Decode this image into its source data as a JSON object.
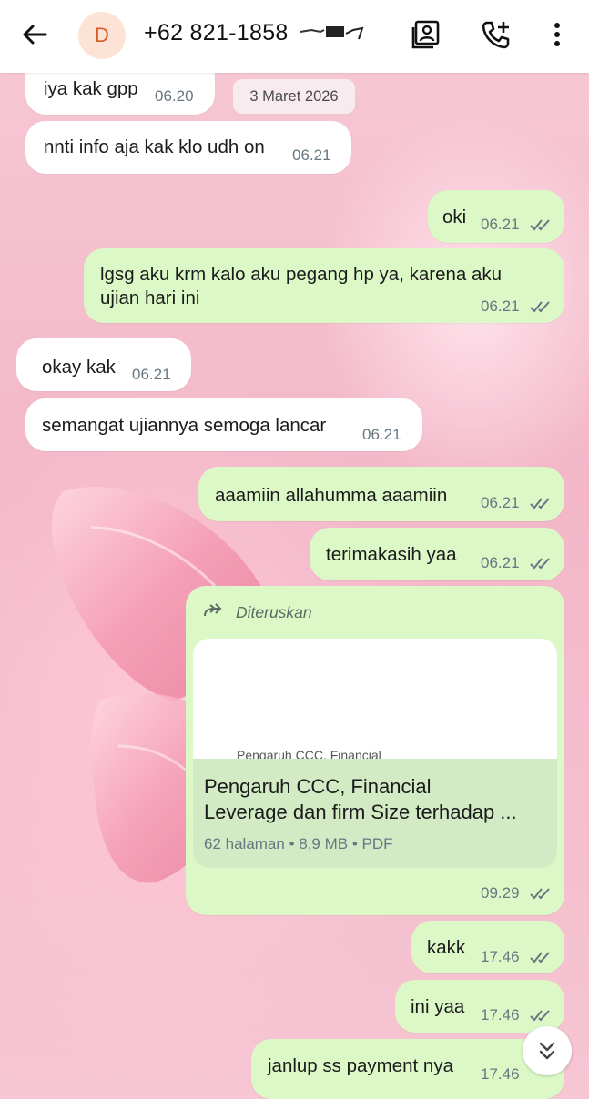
{
  "header": {
    "avatar_letter": "D",
    "contact_number": "+62 821-1858"
  },
  "date_chip": "3 Maret 2026",
  "messages": [
    {
      "dir": "in",
      "text": "iya kak gpp",
      "time": "06.20"
    },
    {
      "dir": "in",
      "text": "nnti info aja kak klo udh on",
      "time": "06.21"
    },
    {
      "dir": "out",
      "text": "oki",
      "time": "06.21"
    },
    {
      "dir": "out",
      "line1": "lgsg aku krm kalo aku pegang hp ya, karena aku",
      "line2": "ujian hari ini",
      "time": "06.21"
    },
    {
      "dir": "in",
      "text": "okay kak",
      "time": "06.21"
    },
    {
      "dir": "in",
      "text": "semangat ujiannya semoga lancar",
      "time": "06.21"
    },
    {
      "dir": "out",
      "text": "aaamiin allahumma aaamiin",
      "time": "06.21"
    },
    {
      "dir": "out",
      "text": "terimakasih yaa",
      "time": "06.21"
    },
    {
      "dir": "out",
      "forwarded_label": "Diteruskan",
      "doc": {
        "preview_text": "Pengaruh CCC, Financial",
        "title_line1": "Pengaruh CCC, Financial",
        "title_line2": "Leverage dan firm Size terhadap ...",
        "meta": "62 halaman • 8,9 MB • PDF"
      },
      "time": "09.29"
    },
    {
      "dir": "out",
      "text": "kakk",
      "time": "17.46"
    },
    {
      "dir": "out",
      "text": "ini yaa",
      "time": "17.46"
    },
    {
      "dir": "out",
      "text": "janlup ss payment nya",
      "time": "17.46"
    }
  ],
  "colors": {
    "incoming_bubble": "#ffffff",
    "outgoing_bubble": "#dcf8c7",
    "timestamp": "#667781",
    "read_ticks": "#667781",
    "avatar_bg": "#fde3d5",
    "avatar_letter": "#d65c2b"
  },
  "icons": [
    "back-arrow-icon",
    "contact-card-icon",
    "add-call-icon",
    "more-vertical-icon",
    "forward-icon",
    "read-ticks-icon",
    "scroll-down-icon"
  ]
}
